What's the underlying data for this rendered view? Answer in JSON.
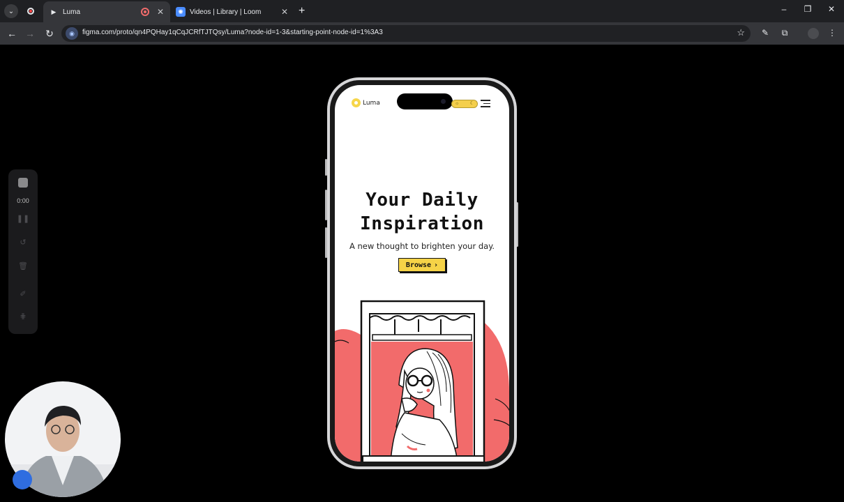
{
  "browser": {
    "tabs": [
      {
        "title": "Luma",
        "active": true
      },
      {
        "title": "Videos | Library | Loom",
        "active": false
      }
    ],
    "url": "figma.com/proto/qn4PQHay1qCqJCRfTJTQsy/Luma?node-id=1-3&starting-point-node-id=1%3A3",
    "new_tab_label": "+",
    "close_glyph": "✕",
    "minimize_glyph": "–",
    "restore_glyph": "❐",
    "back_glyph": "←",
    "forward_glyph": "→",
    "reload_glyph": "↻",
    "star_glyph": "☆"
  },
  "loom": {
    "timer": "0:00",
    "icons": [
      "stop-icon",
      "pause-icon",
      "restart-icon",
      "delete-icon",
      "draw-icon",
      "grid-icon"
    ]
  },
  "app": {
    "logo_text": "Luma",
    "toggle": {
      "sun": "☼",
      "moon": "☾"
    },
    "hero_title_line1": "Your Daily",
    "hero_title_line2": "Inspiration",
    "hero_subtitle": "A new thought to brighten your day.",
    "browse_label": "Browse",
    "browse_arrow": "›",
    "colors": {
      "accent_yellow": "#f6d347",
      "coral": "#f26b6b",
      "ink": "#111111"
    }
  }
}
